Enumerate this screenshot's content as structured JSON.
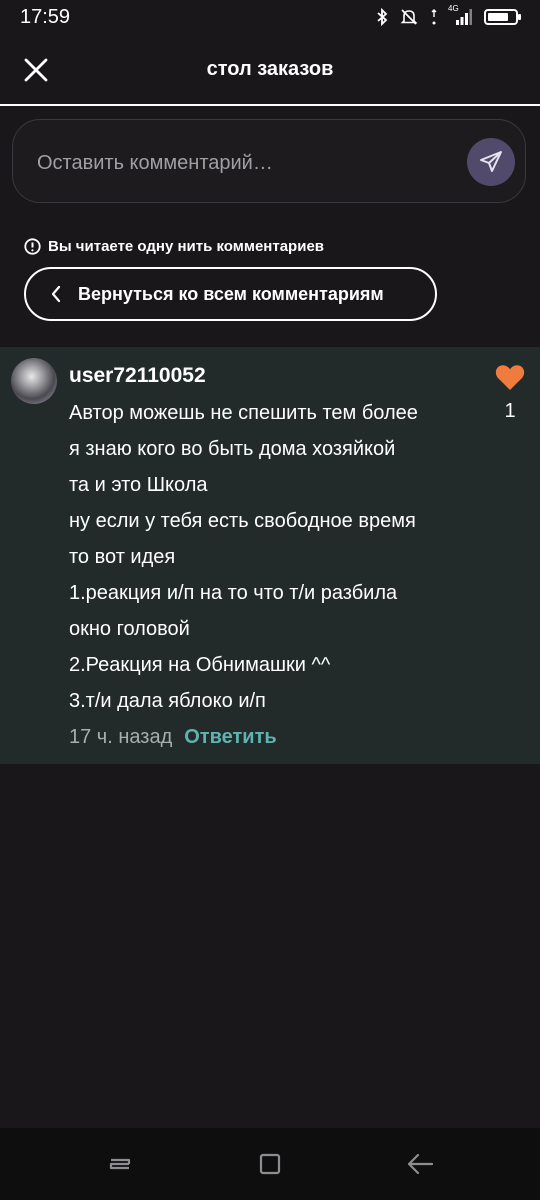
{
  "status_bar": {
    "time": "17:59",
    "network": "4G",
    "icons": [
      "bluetooth-icon",
      "mute-icon",
      "data-arrows-icon",
      "signal-icon",
      "battery-icon"
    ]
  },
  "header": {
    "title": "стол заказов",
    "close_icon": "close-icon"
  },
  "comment_input": {
    "placeholder": "Оставить комментарий…",
    "send_icon": "send-icon"
  },
  "thread_notice": {
    "icon": "info-icon",
    "text": "Вы читаете одну нить комментариев"
  },
  "back_button": {
    "icon": "chevron-left-icon",
    "label": "Вернуться ко всем комментариям"
  },
  "comment": {
    "username": "user72110052",
    "lines": [
      "Автор можешь не спешить тем более",
      "я знаю кого во быть дома хозяйкой",
      "та и это Школа",
      "ну если у тебя есть свободное время",
      "то вот идея",
      "1.реакция и/п на то что т/и разбила",
      "окно головой",
      "2.Реакция на Обнимашки ^^",
      "3.т/и дала яблоко и/п"
    ],
    "time": "17 ч. назад",
    "reply_label": "Ответить",
    "likes": "1"
  },
  "colors": {
    "background": "#19171a",
    "card": "#222a2a",
    "accent_reply": "#5eb3b0",
    "heart": "#f07b3f",
    "send_button": "#514a6b"
  },
  "nav_bar": {
    "icons": [
      "recents-icon",
      "home-icon",
      "back-arrow-icon"
    ]
  }
}
